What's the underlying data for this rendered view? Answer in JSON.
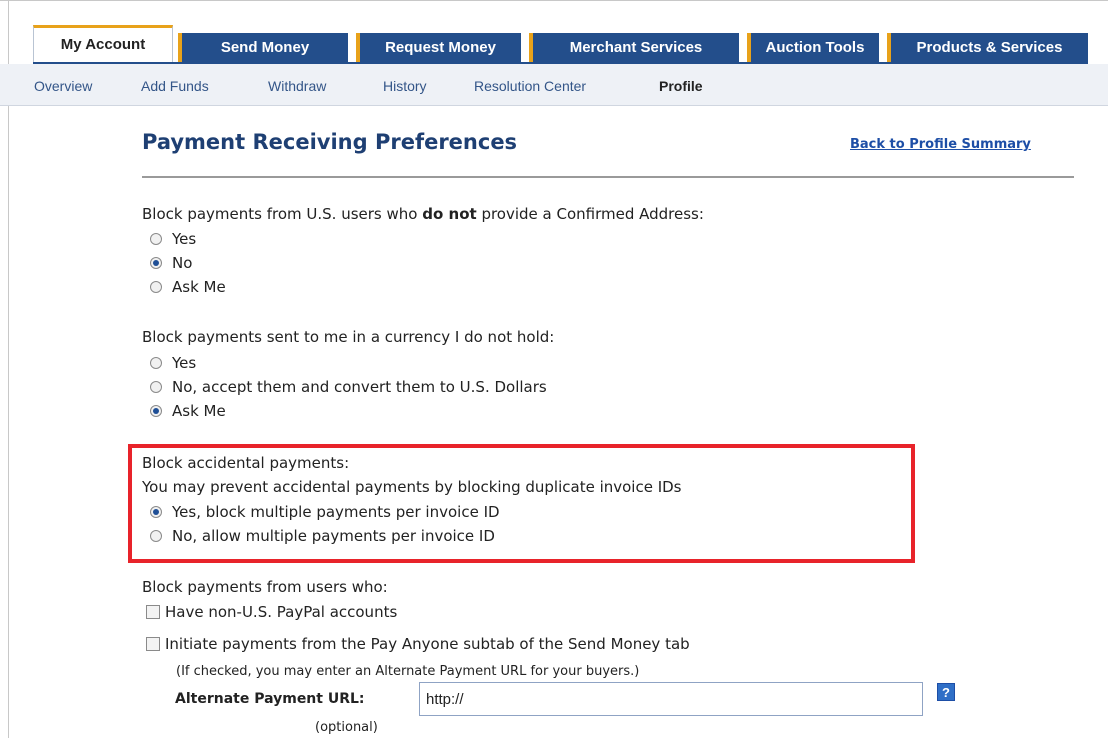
{
  "tabs": [
    {
      "label": "My Account",
      "active": true
    },
    {
      "label": "Send Money",
      "active": false
    },
    {
      "label": "Request Money",
      "active": false
    },
    {
      "label": "Merchant Services",
      "active": false
    },
    {
      "label": "Auction Tools",
      "active": false
    },
    {
      "label": "Products & Services",
      "active": false
    }
  ],
  "subnav": [
    "Overview",
    "Add Funds",
    "Withdraw",
    "History",
    "Resolution Center",
    "Profile"
  ],
  "subnav_current": "Profile",
  "page": {
    "title": "Payment Receiving Preferences",
    "back_link": "Back to Profile Summary"
  },
  "section1": {
    "question_pre": "Block payments from U.S. users who ",
    "question_bold": "do not",
    "question_post": " provide a Confirmed Address:",
    "options": [
      "Yes",
      "No",
      "Ask Me"
    ],
    "selected": "No"
  },
  "section2": {
    "question": "Block payments sent to me in a currency I do not hold:",
    "options": [
      "Yes",
      "No, accept them and convert them to U.S. Dollars",
      "Ask Me"
    ],
    "selected": "Ask Me"
  },
  "section3": {
    "question": "Block accidental payments:",
    "description": "You may prevent accidental payments by blocking duplicate invoice IDs",
    "options": [
      "Yes, block multiple payments per invoice ID",
      "No, allow multiple payments per invoice ID"
    ],
    "selected": "Yes, block multiple payments per invoice ID"
  },
  "section4": {
    "question": "Block payments from users who:",
    "checkboxes": [
      {
        "label": "Have non-U.S. PayPal accounts",
        "checked": false
      },
      {
        "label": "Initiate payments from the Pay Anyone subtab of the Send Money tab",
        "checked": false
      }
    ],
    "note": "(If checked, you may enter an Alternate Payment URL for your buyers.)",
    "alt_url_label": "Alternate Payment URL:",
    "alt_url_value": "http://",
    "help": "?",
    "optional": "(optional)"
  },
  "colors": {
    "tab_blue": "#234e8b",
    "tab_accent": "#e8a21a",
    "title_blue": "#1e3f73",
    "highlight_red": "#e8232a"
  }
}
